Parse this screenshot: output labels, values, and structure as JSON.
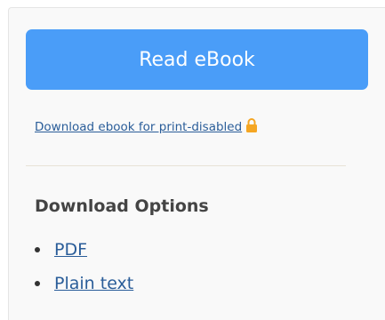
{
  "read_button": {
    "label": "Read eBook"
  },
  "print_disabled_link": {
    "label": "Download ebook for print-disabled",
    "icon": "lock-icon",
    "icon_color": "#f5a623"
  },
  "download_options": {
    "title": "Download Options",
    "items": [
      {
        "label": "PDF"
      },
      {
        "label": "Plain text"
      }
    ]
  },
  "colors": {
    "primary_button": "#4a9df8",
    "link": "#2a5d99",
    "panel_bg": "#f9f9f9"
  }
}
